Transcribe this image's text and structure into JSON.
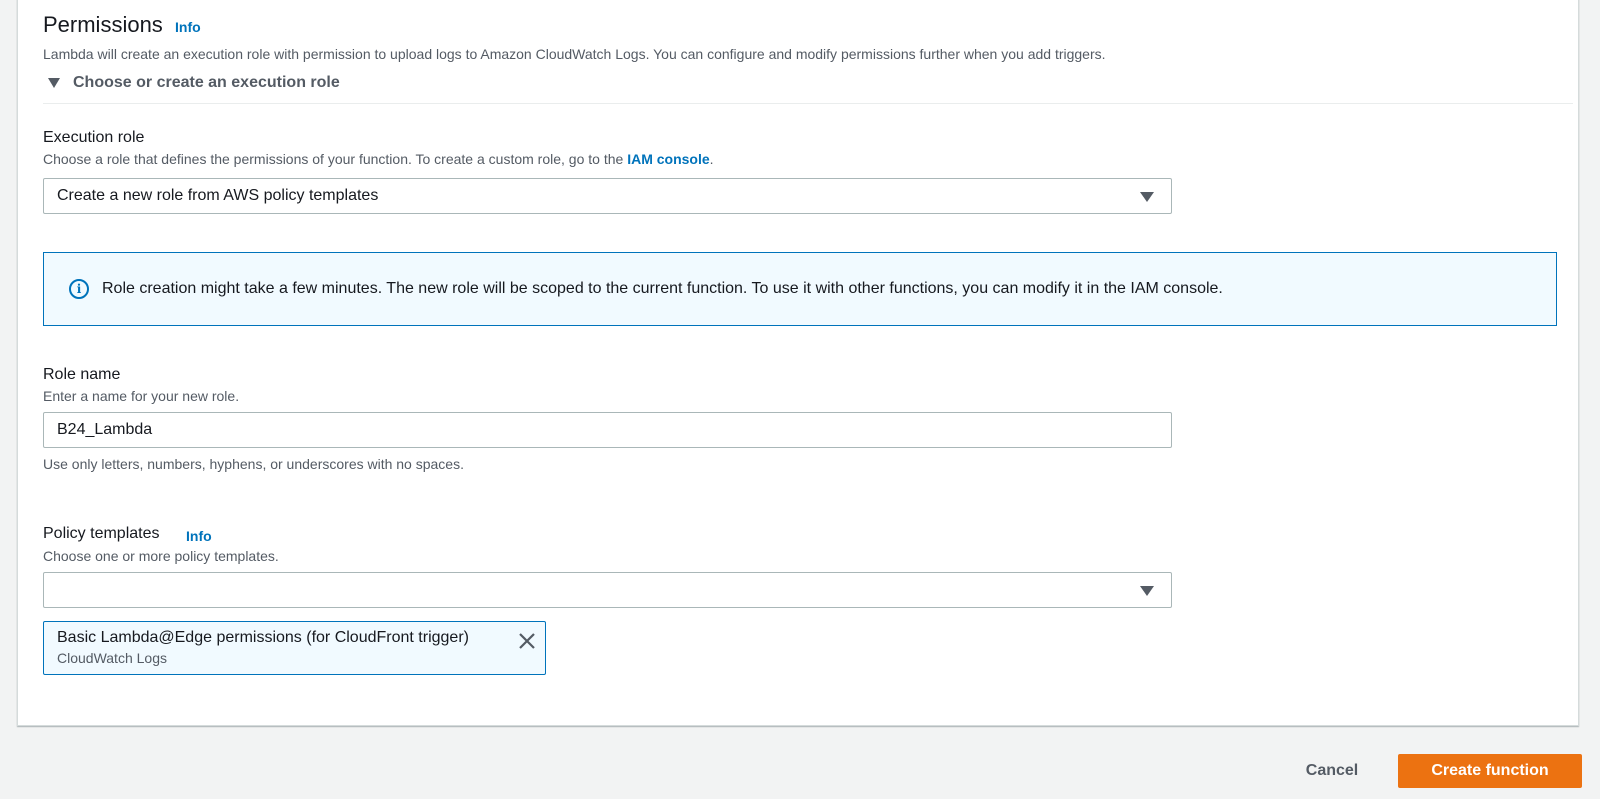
{
  "permissions": {
    "title": "Permissions",
    "info_label": "Info",
    "description": "Lambda will create an execution role with permission to upload logs to Amazon CloudWatch Logs. You can configure and modify permissions further when you add triggers.",
    "expander_label": "Choose or create an execution role"
  },
  "execution_role": {
    "label": "Execution role",
    "description_prefix": "Choose a role that defines the permissions of your function. To create a custom role, go to the ",
    "iam_link": "IAM console",
    "description_suffix": ".",
    "selected_value": "Create a new role from AWS policy templates"
  },
  "alert": {
    "text": "Role creation might take a few minutes. The new role will be scoped to the current function. To use it with other functions, you can modify it in the IAM console."
  },
  "role_name": {
    "label": "Role name",
    "description": "Enter a name for your new role.",
    "value": "B24_Lambda",
    "constraint": "Use only letters, numbers, hyphens, or underscores with no spaces."
  },
  "policy_templates": {
    "label": "Policy templates",
    "info_label": "Info",
    "description": "Choose one or more policy templates.",
    "selected_value": "",
    "tokens": [
      {
        "title": "Basic Lambda@Edge permissions (for CloudFront trigger)",
        "subtitle": "CloudWatch Logs"
      }
    ]
  },
  "footer": {
    "cancel_label": "Cancel",
    "create_label": "Create function"
  },
  "colors": {
    "link": "#0073bb",
    "primary_button": "#ec7211",
    "alert_border": "#0073bb",
    "alert_bg": "#f1faff"
  },
  "icons": {
    "info": "info-circle-icon",
    "remove": "close-icon",
    "dropdown": "caret-down-icon"
  }
}
